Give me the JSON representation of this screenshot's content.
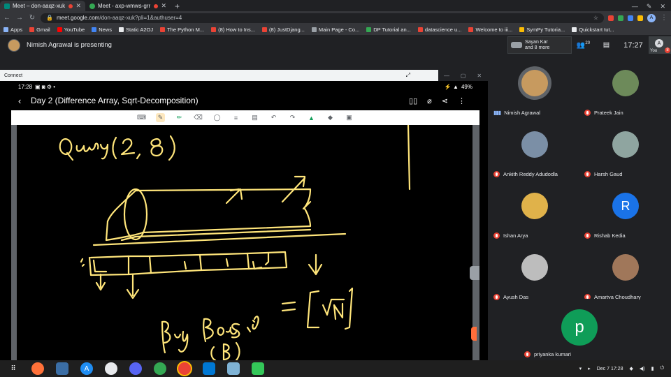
{
  "browser": {
    "tabs": [
      {
        "title": "Meet – don-aaqz-xuk",
        "favicon_color": "#00897b",
        "recording": true,
        "active": true
      },
      {
        "title": "Meet - axp-wmws-grr",
        "favicon_color": "#34a853",
        "recording": true,
        "active": false
      }
    ],
    "new_tab": "+",
    "window_controls": [
      "—",
      "✎",
      "✕"
    ],
    "url_host": "meet.google.com",
    "url_path": "/don-aaqz-xuk?pli=1&authuser=4",
    "profile_initial": "A",
    "bookmarks": [
      {
        "label": "Apps",
        "color": "#8ab4f8"
      },
      {
        "label": "Gmail",
        "color": "#ea4335"
      },
      {
        "label": "YouTube",
        "color": "#ff0000"
      },
      {
        "label": "News",
        "color": "#4285f4"
      },
      {
        "label": "Static A2OJ",
        "color": "#e8eaed"
      },
      {
        "label": "The Python M...",
        "color": "#ea4335"
      },
      {
        "label": "(8) How to Ins...",
        "color": "#ea4335"
      },
      {
        "label": "(8) JustDjang...",
        "color": "#ea4335"
      },
      {
        "label": "Main Page - Co...",
        "color": "#9aa0a6"
      },
      {
        "label": "DP Tutorial an...",
        "color": "#34a853"
      },
      {
        "label": "datascience u...",
        "color": "#ea4335"
      },
      {
        "label": "Welcome to iii...",
        "color": "#ea4335"
      },
      {
        "label": "SymPy Tutoria...",
        "color": "#fbbc04"
      },
      {
        "label": "Quickstart tut...",
        "color": "#e8eaed"
      }
    ]
  },
  "meet": {
    "presenting_text": "Nimish Agrawal is presenting",
    "top_thumb_line1": "Sayan Kar",
    "top_thumb_line2": "and 8 more",
    "people_count": "20",
    "clock": "17:27",
    "you_label": "You",
    "you_initial": "A",
    "you_badge": "8"
  },
  "screen": {
    "connect_label": "Connect",
    "status_time": "17:28",
    "status_battery": "49%",
    "doc_title": "Day 2 (Difference Array, Sqrt-Decomposition)",
    "back_icon": "‹"
  },
  "participants": [
    {
      "name": "Nimish Agrawal",
      "initial": "",
      "color": "#c79a5f",
      "muted": false,
      "speaking": true
    },
    {
      "name": "Prateek Jain",
      "initial": "",
      "color": "#6d8a5a",
      "muted": true
    },
    {
      "name": "Ankith Reddy Adudodla",
      "initial": "",
      "color": "#7b8fa6",
      "muted": true
    },
    {
      "name": "Harsh Gaud",
      "initial": "",
      "color": "#8fa5a0",
      "muted": true
    },
    {
      "name": "Ishan Arya",
      "initial": "",
      "color": "#e0b24a",
      "muted": true
    },
    {
      "name": "Rishab Kedia",
      "initial": "R",
      "color": "#1a73e8",
      "muted": true
    },
    {
      "name": "Ayush Das",
      "initial": "",
      "color": "#bdbdbd",
      "muted": true
    },
    {
      "name": "Amartya Choudhary",
      "initial": "",
      "color": "#a0775a",
      "muted": true
    },
    {
      "name": "priyanka kumari",
      "initial": "p",
      "color": "#0f9d58",
      "muted": true
    }
  ],
  "taskbar": {
    "date": "Dec 7",
    "time": "17:28"
  }
}
